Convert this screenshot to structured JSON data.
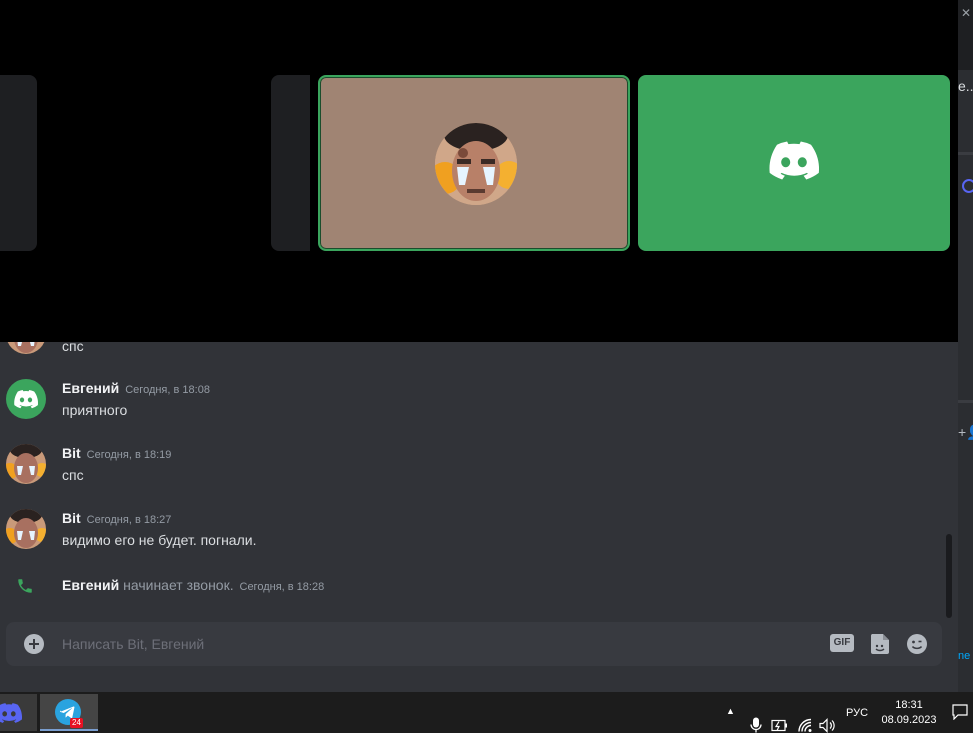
{
  "right_panel": {
    "title_fragment": "е..",
    "add_user_glyph": "+",
    "link_fragment": "ne"
  },
  "messages": [
    {
      "text": "спс"
    },
    {
      "author": "Евгений",
      "time": "Сегодня, в 18:08",
      "text": "приятного",
      "avatar": "discord-icon"
    },
    {
      "author": "Bit",
      "time": "Сегодня, в 18:19",
      "text": "спс",
      "avatar": "user-photo"
    },
    {
      "author": "Bit",
      "time": "Сегодня, в 18:27",
      "text": "видимо его не будет. погнали.",
      "avatar": "user-photo"
    }
  ],
  "call_event": {
    "author": "Евгений",
    "action": "начинает звонок.",
    "time": "Сегодня, в 18:28"
  },
  "composer": {
    "placeholder": "Написать Bit, Евгений",
    "gif_label": "GIF"
  },
  "taskbar": {
    "telegram_badge": "24",
    "lang": "РУС",
    "time": "18:31",
    "date": "08.09.2023"
  },
  "colors": {
    "discord_green": "#3ba55d",
    "chat_bg": "#313338",
    "composer_bg": "#383a40",
    "call_bg": "#000000"
  }
}
